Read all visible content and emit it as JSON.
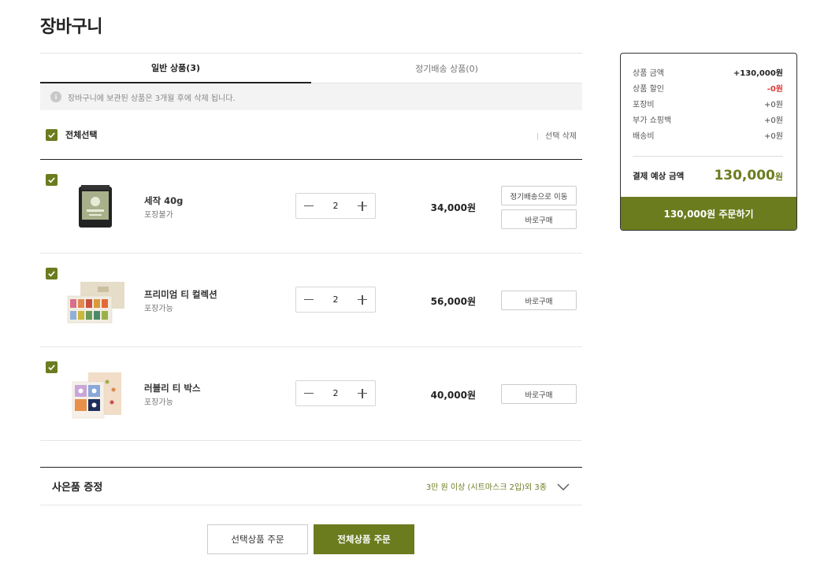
{
  "page": {
    "title": "장바구니"
  },
  "tabs": [
    {
      "label": "일반 상품(3)",
      "active": true
    },
    {
      "label": "정기배송 상품(0)",
      "active": false
    }
  ],
  "notice": {
    "icon": "info-icon",
    "text": "장바구니에 보관된 상품은 3개월 후에 삭제 됩니다."
  },
  "select_bar": {
    "select_all_label": "전체선택",
    "select_all_checked": true,
    "delete_label": "선택 삭제"
  },
  "items": [
    {
      "name": "세작 40g",
      "packaging": "포장불가",
      "quantity": "2",
      "price": "34,000원",
      "checked": true,
      "subscription_label": "정기배송으로 이동",
      "buy_now_label": "바로구매"
    },
    {
      "name": "프리미엄 티 컬렉션",
      "packaging": "포장가능",
      "quantity": "2",
      "price": "56,000원",
      "checked": true,
      "buy_now_label": "바로구매"
    },
    {
      "name": "러블리 티 박스",
      "packaging": "포장가능",
      "quantity": "2",
      "price": "40,000원",
      "checked": true,
      "buy_now_label": "바로구매"
    }
  ],
  "gift": {
    "title": "사은품 증정",
    "description": "3만 원 이상 (시트마스크 2입)외 3종"
  },
  "order_buttons": {
    "selected_label": "선택상품 주문",
    "all_label": "전체상품 주문"
  },
  "summary": {
    "rows": [
      {
        "label": "상품 금액",
        "value": "+130,000원"
      },
      {
        "label": "상품 할인",
        "value": "-0원"
      },
      {
        "label": "포장비",
        "value": "+0원"
      },
      {
        "label": "부가 쇼핑백",
        "value": "+0원"
      },
      {
        "label": "배송비",
        "value": "+0원"
      }
    ],
    "total_label": "결제 예상 금액",
    "total_value": "130,000",
    "total_unit": "원",
    "order_label": "130,000원 주문하기"
  },
  "colors": {
    "accent": "#6b7c1f",
    "discount": "#e03a3a"
  }
}
